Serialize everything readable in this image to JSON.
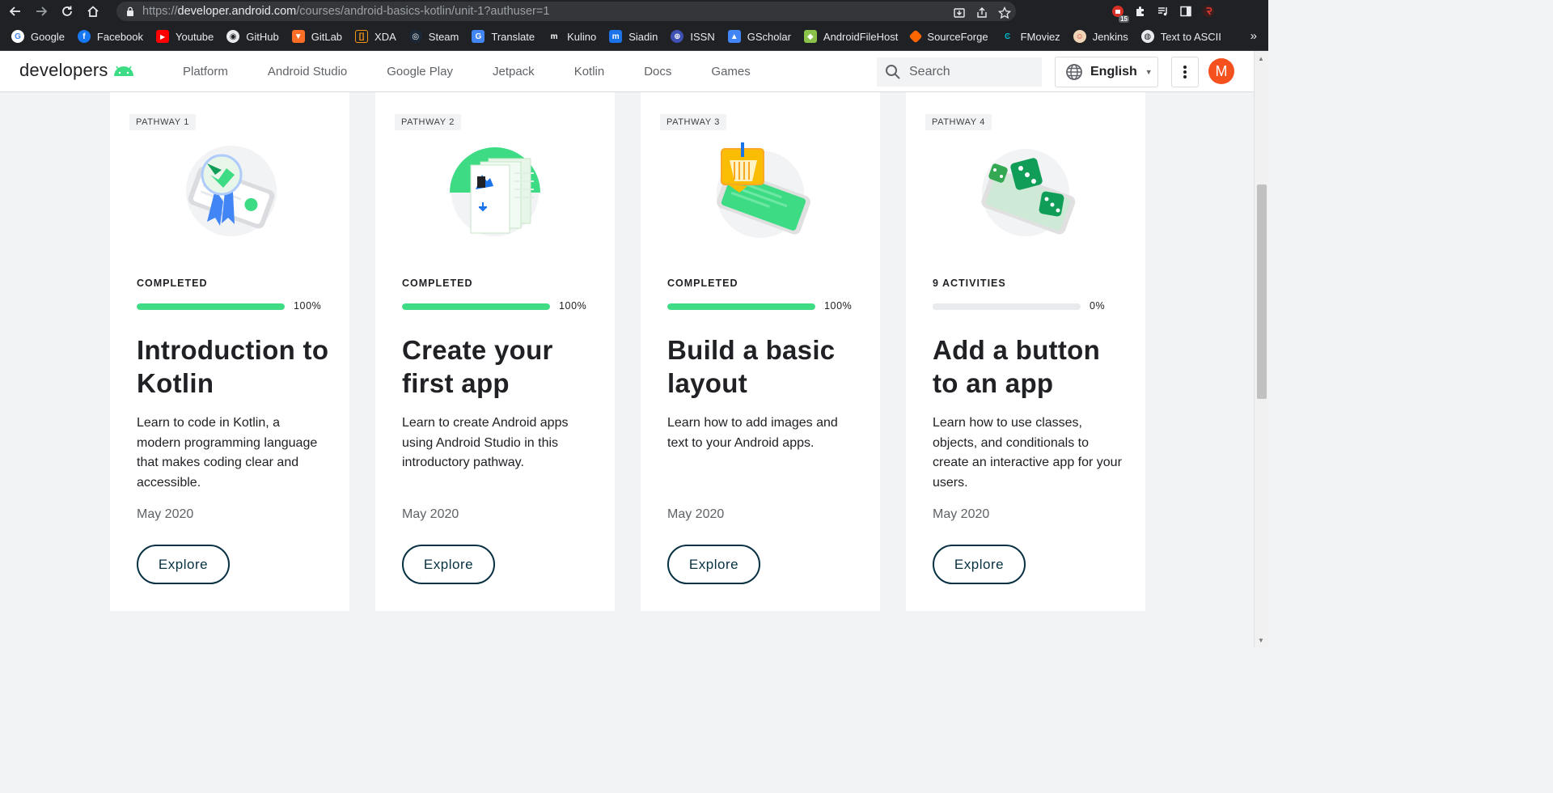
{
  "browser": {
    "url_scheme": "https://",
    "url_host": "developer.android.com",
    "url_path": "/courses/android-basics-kotlin/unit-1?authuser=1",
    "extension_badge": "15"
  },
  "bookmarks": [
    {
      "label": "Google",
      "icon": "google-icon",
      "color": "#ffffff"
    },
    {
      "label": "Facebook",
      "icon": "facebook-icon",
      "color": "#1877f2"
    },
    {
      "label": "Youtube",
      "icon": "youtube-icon",
      "color": "#ff0000"
    },
    {
      "label": "GitHub",
      "icon": "github-icon",
      "color": "#e8eaed"
    },
    {
      "label": "GitLab",
      "icon": "gitlab-icon",
      "color": "#fc6d26"
    },
    {
      "label": "XDA",
      "icon": "xda-icon",
      "color": "#f59714"
    },
    {
      "label": "Steam",
      "icon": "steam-icon",
      "color": "#1b2838"
    },
    {
      "label": "Translate",
      "icon": "translate-icon",
      "color": "#4285f4"
    },
    {
      "label": "Kulino",
      "icon": "kulino-icon",
      "color": "#202124"
    },
    {
      "label": "Siadin",
      "icon": "siadin-icon",
      "color": "#1a73e8"
    },
    {
      "label": "ISSN",
      "icon": "issn-icon",
      "color": "#3f51b5"
    },
    {
      "label": "GScholar",
      "icon": "gscholar-icon",
      "color": "#4285f4"
    },
    {
      "label": "AndroidFileHost",
      "icon": "androidfilehost-icon",
      "color": "#8bc34a"
    },
    {
      "label": "SourceForge",
      "icon": "sourceforge-icon",
      "color": "#ff6600"
    },
    {
      "label": "FMoviez",
      "icon": "fmoviez-icon",
      "color": "#00bcd4"
    },
    {
      "label": "Jenkins",
      "icon": "jenkins-icon",
      "color": "#d33833"
    },
    {
      "label": "Text to ASCII",
      "icon": "globe-icon",
      "color": "#e8eaed"
    }
  ],
  "bookmarks_more": "»",
  "header": {
    "logo_text": "developers",
    "nav": [
      "Platform",
      "Android Studio",
      "Google Play",
      "Jetpack",
      "Kotlin",
      "Docs",
      "Games"
    ],
    "search_placeholder": "Search",
    "language": "English",
    "avatar_initial": "M",
    "avatar_color": "#f4511e",
    "accent_color": "#3ddc84"
  },
  "cards": [
    {
      "pathway": "PATHWAY 1",
      "status": "COMPLETED",
      "progress": 100,
      "percent_label": "100%",
      "title": "Introduction to Kotlin",
      "description": "Learn to code in Kotlin, a modern programming language that makes coding clear and accessible.",
      "date": "May 2020",
      "button": "Explore"
    },
    {
      "pathway": "PATHWAY 2",
      "status": "COMPLETED",
      "progress": 100,
      "percent_label": "100%",
      "title": "Create your first app",
      "description": "Learn to create Android apps using Android Studio in this introductory pathway.",
      "date": "May 2020",
      "button": "Explore"
    },
    {
      "pathway": "PATHWAY 3",
      "status": "COMPLETED",
      "progress": 100,
      "percent_label": "100%",
      "title": "Build a basic layout",
      "description": "Learn how to add images and text to your Android apps.",
      "date": "May 2020",
      "button": "Explore"
    },
    {
      "pathway": "PATHWAY 4",
      "status": "9 ACTIVITIES",
      "progress": 0,
      "percent_label": "0%",
      "title": "Add a button to an app",
      "description": "Learn how to use classes, objects, and conditionals to create an interactive app for your users.",
      "date": "May 2020",
      "button": "Explore"
    }
  ]
}
